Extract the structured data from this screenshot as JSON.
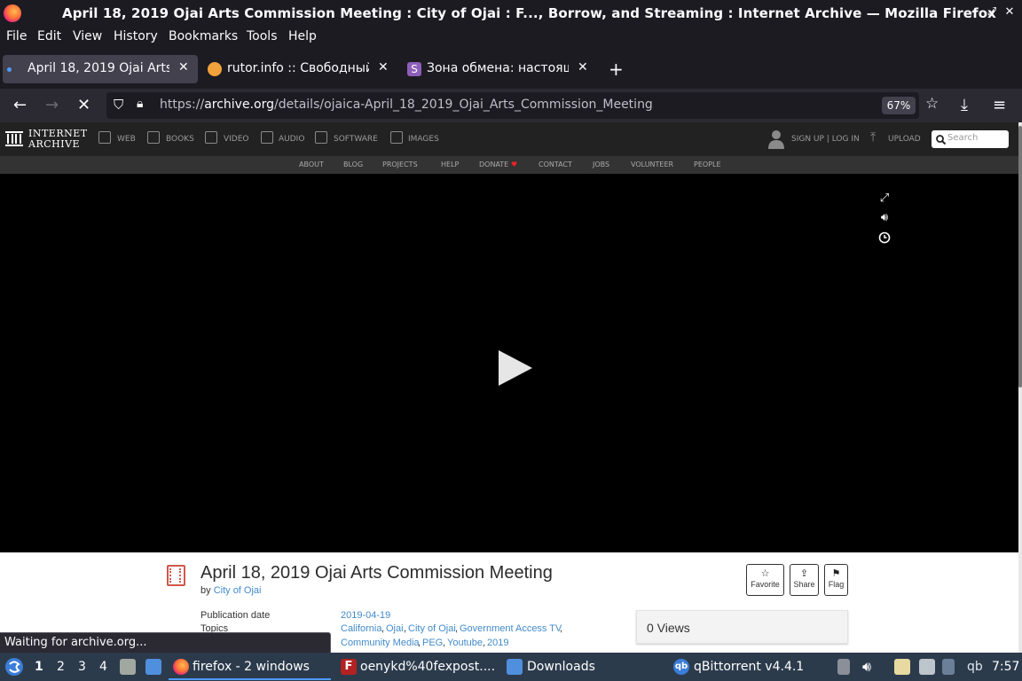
{
  "window": {
    "title": "April 18, 2019 Ojai Arts Commission Meeting : City of Ojai : F..., Borrow, and Streaming : Internet Archive — Mozilla Firefox",
    "controls": [
      "–",
      "⤢",
      "✕"
    ]
  },
  "menu": [
    "File",
    "Edit",
    "View",
    "History",
    "Bookmarks",
    "Tools",
    "Help"
  ],
  "tabs": [
    {
      "label": "April 18, 2019 Ojai Arts C",
      "active": true
    },
    {
      "label": "rutor.info :: Свободный т",
      "active": false
    },
    {
      "label": "Зона обмена: настоящи",
      "active": false
    }
  ],
  "tab_close": "✕",
  "new_tab": "+",
  "navbar": {
    "url_prefix": "https://",
    "url_host": "archive.org",
    "url_path": "/details/ojaica-April_18_2019_Ojai_Arts_Commission_Meeting",
    "zoom": "67%"
  },
  "ia_header": {
    "logo_line1": "INTERNET",
    "logo_line2": "ARCHIVE",
    "nav": [
      "WEB",
      "BOOKS",
      "VIDEO",
      "AUDIO",
      "SOFTWARE",
      "IMAGES"
    ],
    "signup": "SIGN UP | LOG IN",
    "upload": "UPLOAD",
    "search_placeholder": "Search",
    "subnav": [
      "ABOUT",
      "BLOG",
      "PROJECTS",
      "HELP",
      "DONATE",
      "CONTACT",
      "JOBS",
      "VOLUNTEER",
      "PEOPLE"
    ]
  },
  "item": {
    "title": "April 18, 2019 Ojai Arts Commission Meeting",
    "by_prefix": "by",
    "by_name": "City of Ojai",
    "pubdate_label": "Publication date",
    "pubdate": "2019-04-19",
    "topics_label": "Topics",
    "topics_line1": [
      "California",
      "Ojai",
      "City of Ojai",
      "Government Access TV"
    ],
    "topics_line2": [
      "Community Media",
      "PEG",
      "Youtube",
      "2019"
    ],
    "actions": [
      {
        "label": "Favorite",
        "icon": "☆"
      },
      {
        "label": "Share",
        "icon": "⇪"
      },
      {
        "label": "Flag",
        "icon": "⚑"
      }
    ],
    "views": "0 Views"
  },
  "status": "Waiting for archive.org...",
  "taskbar": {
    "workspaces": [
      "1",
      "2",
      "3",
      "4"
    ],
    "tasks": [
      "firefox - 2 windows",
      "oenykd%40fexpost....",
      "Downloads",
      "qBittorrent v4.4.1"
    ],
    "clock": "7:57",
    "tray_qb": "qb"
  },
  "colors": {
    "accent_link": "#428bca",
    "video_bg": "#000000",
    "taskbar": "#2c3b4c"
  }
}
